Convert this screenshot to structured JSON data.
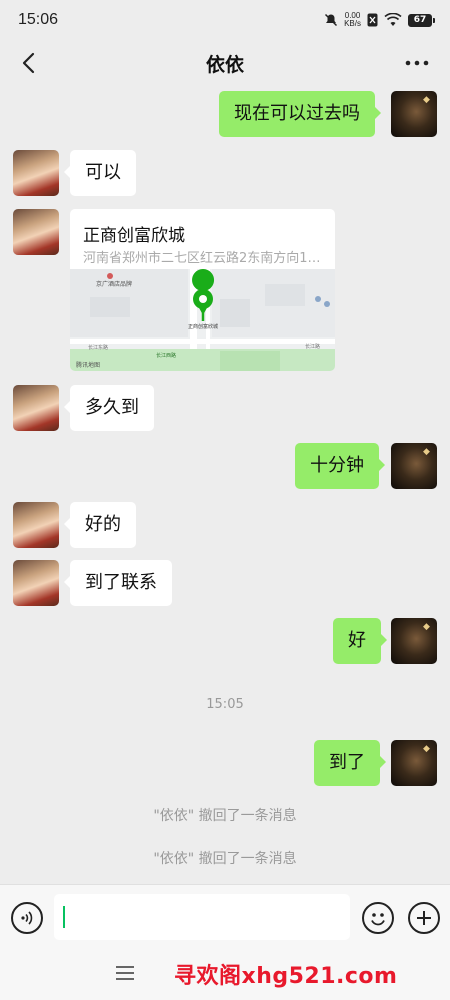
{
  "status_bar": {
    "time": "15:06",
    "net_speed_value": "0.00",
    "net_speed_unit": "KB/s",
    "battery": "67"
  },
  "header": {
    "title": "依依",
    "back_icon": "chevron-left-icon",
    "more_icon": "more-dots-icon"
  },
  "messages": [
    {
      "side": "out",
      "text": "现在可以过去吗"
    },
    {
      "side": "in",
      "text": "可以"
    },
    {
      "side": "in",
      "type": "location",
      "name": "正商创富欣城",
      "address": "河南省郑州市二七区红云路2东南方向1…"
    },
    {
      "side": "in",
      "text": "多久到"
    },
    {
      "side": "out",
      "text": "十分钟"
    },
    {
      "side": "in",
      "text": "好的"
    },
    {
      "side": "in",
      "text": "到了联系"
    },
    {
      "side": "out",
      "text": "好"
    },
    {
      "side": "out",
      "text": "到了"
    }
  ],
  "time_divider": "15:05",
  "system_messages": [
    "\"依依\" 撤回了一条消息",
    "\"依依\" 撤回了一条消息"
  ],
  "map_labels": {
    "poi_1": "京广酒店品牌",
    "poi_2": "正商创富欣城",
    "road_1": "长江东路",
    "road_2": "长江路",
    "poi_3": "长江西路",
    "attribution": "腾讯地图"
  },
  "input_bar": {
    "placeholder": "",
    "voice_icon": "voice-icon",
    "emoji_icon": "emoji-icon",
    "plus_icon": "plus-icon"
  },
  "nav": {
    "menu_icon": "menu-icon",
    "watermark": "寻欢阁xhg521.com"
  },
  "colors": {
    "outgoing_bubble": "#95ec69",
    "incoming_bubble": "#ffffff",
    "background": "#ededed",
    "map_pin": "#1aad19"
  }
}
